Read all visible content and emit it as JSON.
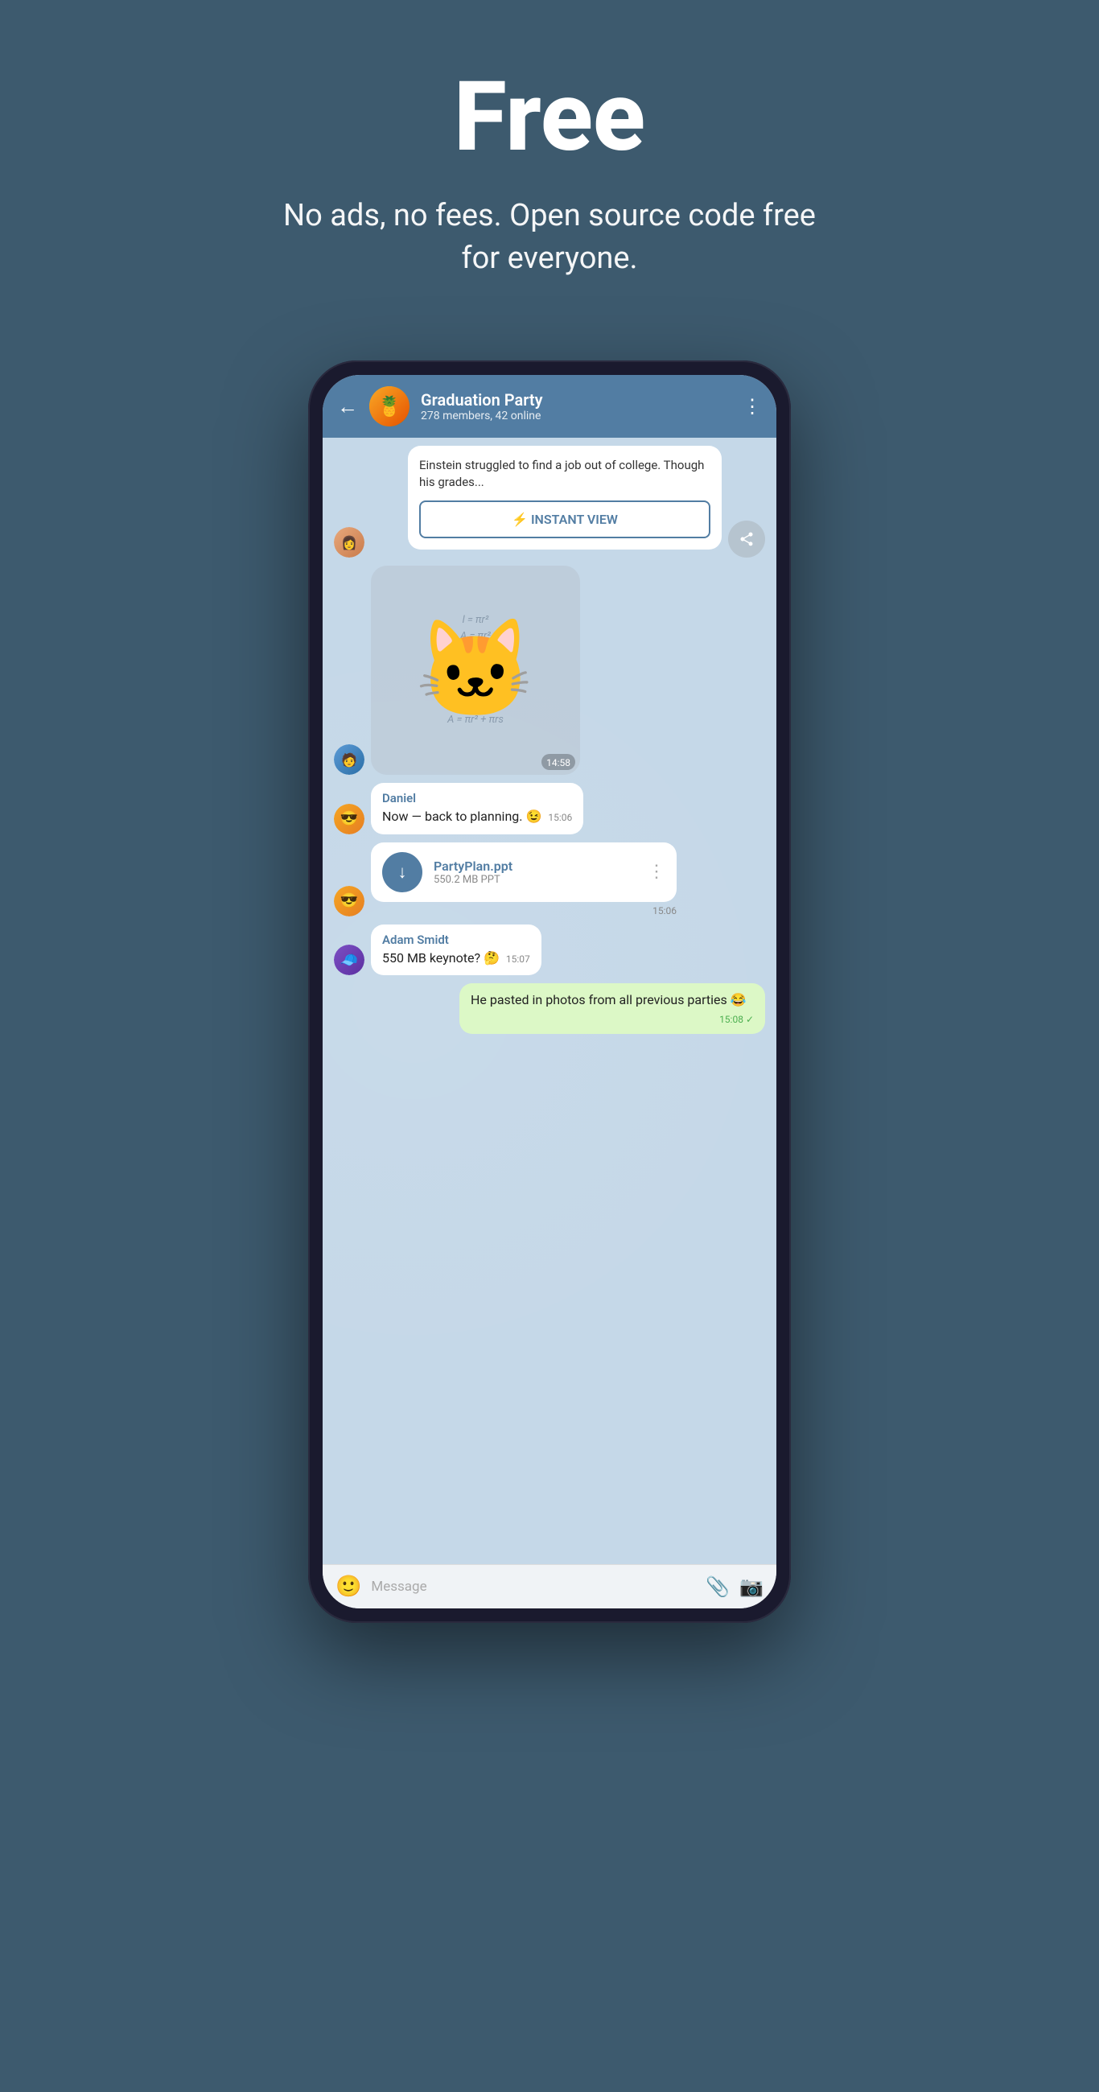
{
  "hero": {
    "title": "Free",
    "subtitle": "No ads, no fees. Open source code free for everyone."
  },
  "chat": {
    "back_label": "←",
    "group_name": "Graduation Party",
    "group_members": "278 members, 42 online",
    "more_icon": "⋮",
    "article_preview": "Einstein struggled to find a job out of college. Though his grades...",
    "instant_view_label": "⚡ INSTANT VIEW",
    "sticker_time": "14:58",
    "messages": [
      {
        "sender": "Daniel",
        "text": "Now — back to planning. 😉",
        "time": "15:06",
        "type": "text"
      },
      {
        "sender": "Daniel",
        "file_name": "PartyPlan.ppt",
        "file_size": "550.2 MB PPT",
        "time": "15:06",
        "type": "file"
      },
      {
        "sender": "Adam Smidt",
        "text": "550 MB keynote? 🤔",
        "time": "15:07",
        "type": "text"
      },
      {
        "sender": "me",
        "text": "He pasted in photos from all previous parties 😂",
        "time": "15:08",
        "type": "outgoing"
      }
    ],
    "input_placeholder": "Message"
  }
}
